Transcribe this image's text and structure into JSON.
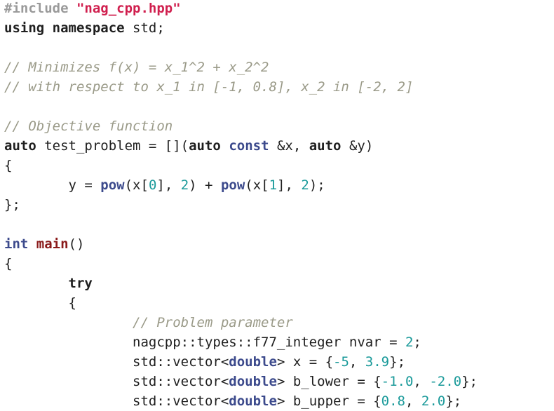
{
  "editor": {
    "lines": [
      [
        {
          "t": "#include ",
          "c": "pp"
        },
        {
          "t": "\"nag_cpp.hpp\"",
          "c": "str"
        }
      ],
      [
        {
          "t": "using",
          "c": "kw"
        },
        {
          "t": " ",
          "c": "tx"
        },
        {
          "t": "namespace",
          "c": "kw"
        },
        {
          "t": " std;",
          "c": "tx"
        }
      ],
      [],
      [
        {
          "t": "// Minimizes f(x) = x_1^2 + x_2^2",
          "c": "cm"
        }
      ],
      [
        {
          "t": "// with respect to x_1 in [-1, 0.8], x_2 in [-2, 2]",
          "c": "cm"
        }
      ],
      [],
      [
        {
          "t": "// Objective function",
          "c": "cm"
        }
      ],
      [
        {
          "t": "auto",
          "c": "kw"
        },
        {
          "t": " test_problem = [](",
          "c": "tx"
        },
        {
          "t": "auto",
          "c": "kw"
        },
        {
          "t": " ",
          "c": "tx"
        },
        {
          "t": "const",
          "c": "type"
        },
        {
          "t": " &x, ",
          "c": "tx"
        },
        {
          "t": "auto",
          "c": "kw"
        },
        {
          "t": " &y)",
          "c": "tx"
        }
      ],
      [
        {
          "t": "{",
          "c": "tx"
        }
      ],
      [
        {
          "t": "        y = ",
          "c": "tx"
        },
        {
          "t": "pow",
          "c": "call"
        },
        {
          "t": "(x[",
          "c": "tx"
        },
        {
          "t": "0",
          "c": "num"
        },
        {
          "t": "], ",
          "c": "tx"
        },
        {
          "t": "2",
          "c": "num"
        },
        {
          "t": ") + ",
          "c": "tx"
        },
        {
          "t": "pow",
          "c": "call"
        },
        {
          "t": "(x[",
          "c": "tx"
        },
        {
          "t": "1",
          "c": "num"
        },
        {
          "t": "], ",
          "c": "tx"
        },
        {
          "t": "2",
          "c": "num"
        },
        {
          "t": ");",
          "c": "tx"
        }
      ],
      [
        {
          "t": "};",
          "c": "tx"
        }
      ],
      [],
      [
        {
          "t": "int",
          "c": "type"
        },
        {
          "t": " ",
          "c": "tx"
        },
        {
          "t": "main",
          "c": "fn"
        },
        {
          "t": "()",
          "c": "tx"
        }
      ],
      [
        {
          "t": "{",
          "c": "tx"
        }
      ],
      [
        {
          "t": "        ",
          "c": "tx"
        },
        {
          "t": "try",
          "c": "kw"
        }
      ],
      [
        {
          "t": "        {",
          "c": "tx"
        }
      ],
      [
        {
          "t": "                // Problem parameter",
          "c": "cm"
        }
      ],
      [
        {
          "t": "                nagcpp::types::f77_integer nvar = ",
          "c": "tx"
        },
        {
          "t": "2",
          "c": "num"
        },
        {
          "t": ";",
          "c": "tx"
        }
      ],
      [
        {
          "t": "                std::vector<",
          "c": "tx"
        },
        {
          "t": "double",
          "c": "type"
        },
        {
          "t": "> x = {",
          "c": "tx"
        },
        {
          "t": "-5",
          "c": "num"
        },
        {
          "t": ", ",
          "c": "tx"
        },
        {
          "t": "3.9",
          "c": "num"
        },
        {
          "t": "};",
          "c": "tx"
        }
      ],
      [
        {
          "t": "                std::vector<",
          "c": "tx"
        },
        {
          "t": "double",
          "c": "type"
        },
        {
          "t": "> b_lower = {",
          "c": "tx"
        },
        {
          "t": "-1.0",
          "c": "num"
        },
        {
          "t": ", ",
          "c": "tx"
        },
        {
          "t": "-2.0",
          "c": "num"
        },
        {
          "t": "};",
          "c": "tx"
        }
      ],
      [
        {
          "t": "                std::vector<",
          "c": "tx"
        },
        {
          "t": "double",
          "c": "type"
        },
        {
          "t": "> b_upper = {",
          "c": "tx"
        },
        {
          "t": "0.8",
          "c": "num"
        },
        {
          "t": ", ",
          "c": "tx"
        },
        {
          "t": "2.0",
          "c": "num"
        },
        {
          "t": "};",
          "c": "tx"
        }
      ]
    ]
  }
}
